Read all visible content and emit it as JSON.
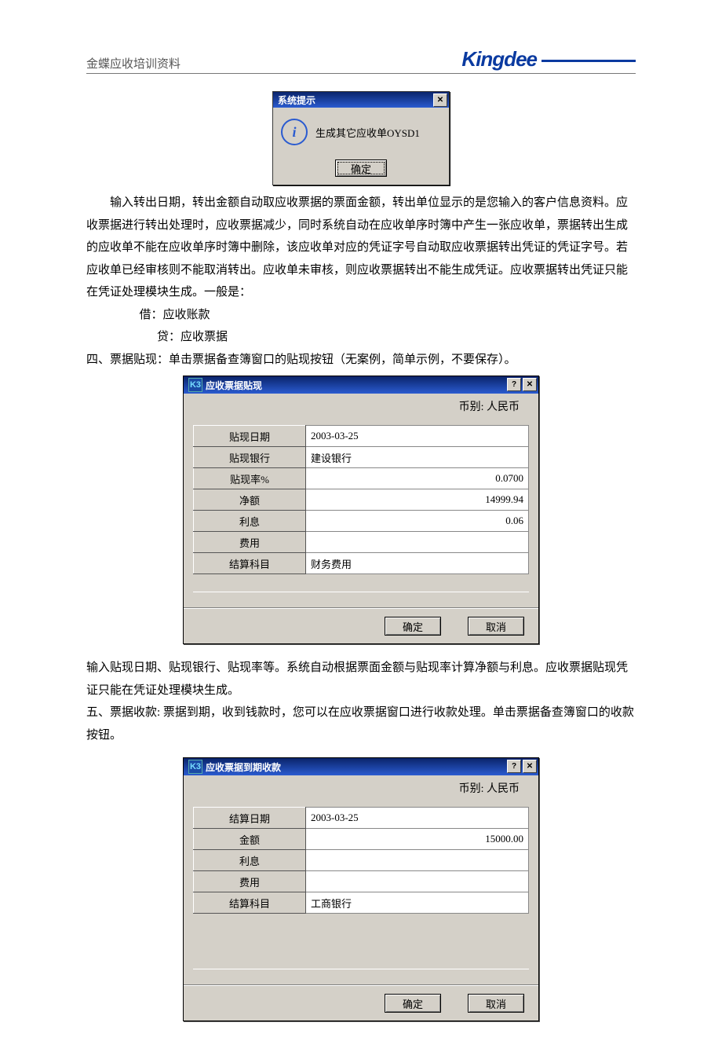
{
  "header": {
    "doc_title": "金蝶应收培训资料",
    "logo_text": "Kingdee"
  },
  "dlg_prompt": {
    "title": "系统提示",
    "message": "生成其它应收单OYSD1",
    "ok": "确定"
  },
  "body": {
    "p1": "输入转出日期，转出金额自动取应收票据的票面金额，转出单位显示的是您输入的客户信息资料。应收票据进行转出处理时，应收票据减少，同时系统自动在应收单序时簿中产生一张应收单，票据转出生成的应收单不能在应收单序时簿中删除，该应收单对应的凭证字号自动取应收票据转出凭证的凭证字号。若应收单已经审核则不能取消转出。应收单未审核，则应收票据转出不能生成凭证。应收票据转出凭证只能在凭证处理模块生成。一般是：",
    "p_debit": "借：应收账款",
    "p_credit": "贷：应收票据",
    "p_section4": "四、票据贴现：单击票据备查簿窗口的贴现按钮（无案例，简单示例，不要保存）。",
    "p_after4a": "输入贴现日期、贴现银行、贴现率等。系统自动根据票面金额与贴现率计算净额与利息。应收票据贴现凭证只能在凭证处理模块生成。",
    "p_section5": "五、票据收款: 票据到期，收到钱款时，您可以在应收票据窗口进行收款处理。单击票据备查簿窗口的收款按钮。"
  },
  "dlg_discount": {
    "title": "应收票据贴现",
    "currency_label": "币别: 人民币",
    "rows": [
      {
        "label": "贴现日期",
        "value": "2003-03-25",
        "align": "left"
      },
      {
        "label": "贴现银行",
        "value": "建设银行",
        "align": "left"
      },
      {
        "label": "贴现率%",
        "value": "0.0700",
        "align": "right"
      },
      {
        "label": "净额",
        "value": "14999.94",
        "align": "right"
      },
      {
        "label": "利息",
        "value": "0.06",
        "align": "right"
      },
      {
        "label": "费用",
        "value": "",
        "align": "right"
      },
      {
        "label": "结算科目",
        "value": "财务费用",
        "align": "left"
      }
    ],
    "ok": "确定",
    "cancel": "取消"
  },
  "dlg_collect": {
    "title": "应收票据到期收款",
    "currency_label": "币别: 人民币",
    "rows": [
      {
        "label": "结算日期",
        "value": "2003-03-25",
        "align": "left"
      },
      {
        "label": "金额",
        "value": "15000.00",
        "align": "right"
      },
      {
        "label": "利息",
        "value": "",
        "align": "right"
      },
      {
        "label": "费用",
        "value": "",
        "align": "right"
      },
      {
        "label": "结算科目",
        "value": "工商银行",
        "align": "left"
      }
    ],
    "ok": "确定",
    "cancel": "取消"
  }
}
